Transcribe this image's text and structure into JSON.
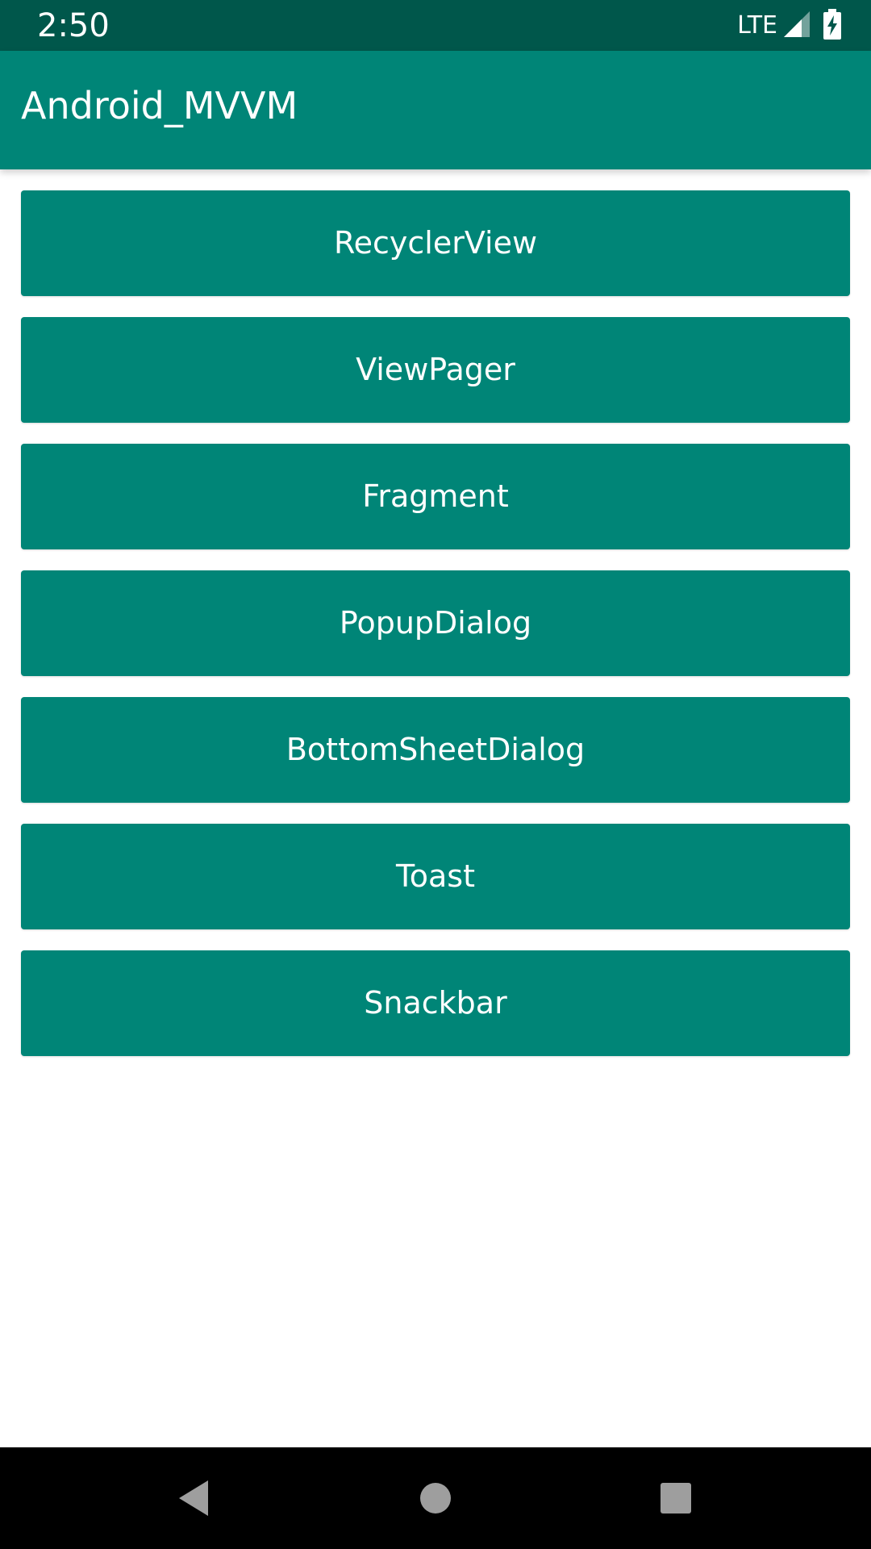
{
  "status_bar": {
    "time": "2:50",
    "network": "LTE",
    "icons": [
      "signal-icon",
      "battery-charging-icon"
    ]
  },
  "app_bar": {
    "title": "Android_MVVM"
  },
  "buttons": [
    {
      "label": "RecyclerView"
    },
    {
      "label": "ViewPager"
    },
    {
      "label": "Fragment"
    },
    {
      "label": "PopupDialog"
    },
    {
      "label": "BottomSheetDialog"
    },
    {
      "label": "Toast"
    },
    {
      "label": "Snackbar"
    }
  ],
  "nav_bar": {
    "icons": [
      "back-icon",
      "home-icon",
      "recents-icon"
    ]
  },
  "colors": {
    "status_bar": "#00574b",
    "primary": "#008577",
    "button_text": "#ffffff",
    "nav_bar": "#000000",
    "nav_icon": "#9e9e9e"
  }
}
